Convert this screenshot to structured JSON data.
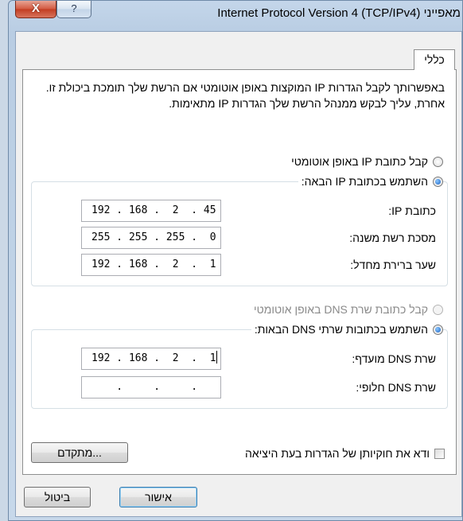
{
  "window": {
    "title": "מאפייני Internet Protocol Version 4 (TCP/IPv4)",
    "close_label": "X",
    "help_label": "?"
  },
  "tabs": [
    {
      "label": "כללי"
    }
  ],
  "general": {
    "description": "באפשרותך לקבל הגדרות IP המוקצות באופן אוטומטי אם הרשת שלך תומכת ביכולת זו. אחרת, עליך לבקש ממנהל הרשת שלך הגדרות IP מתאימות.",
    "ip_auto_option": {
      "label": "קבל כתובת IP באופן אוטומטי",
      "checked": false
    },
    "ip_manual_option": {
      "label": "השתמש בכתובת IP הבאה:",
      "checked": true
    },
    "ip_address": {
      "label": "כתובת IP:",
      "value": "192 . 168 .  2  . 45"
    },
    "subnet_mask": {
      "label": "מסכת רשת משנה:",
      "value": "255 . 255 . 255 .  0"
    },
    "default_gateway": {
      "label": "שער ברירת מחדל:",
      "value": "192 . 168 .  2  .  1"
    },
    "dns_auto_option": {
      "label": "קבל כתובת שרת DNS באופן אוטומטי",
      "checked": false,
      "disabled": true
    },
    "dns_manual_option": {
      "label": "השתמש בכתובות שרתי DNS הבאות:",
      "checked": true
    },
    "preferred_dns": {
      "label": "שרת DNS מועדף:",
      "value": "192 . 168 .  2  .  1"
    },
    "alternate_dns": {
      "label": "שרת DNS חלופי:",
      "value": "    .     .     .    "
    },
    "validate_checkbox": {
      "label": "ודא את חוקיותן של הגדרות בעת היציאה",
      "checked": false
    },
    "advanced_button": "מתקדם..."
  },
  "footer": {
    "ok_label": "אישור",
    "cancel_label": "ביטול"
  }
}
